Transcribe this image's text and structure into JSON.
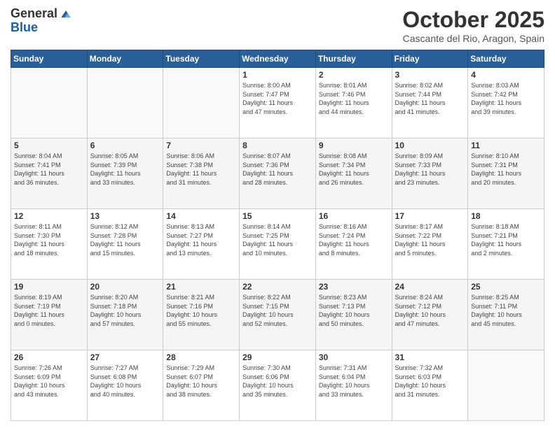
{
  "header": {
    "logo_line1": "General",
    "logo_line2": "Blue",
    "month": "October 2025",
    "location": "Cascante del Rio, Aragon, Spain"
  },
  "days_of_week": [
    "Sunday",
    "Monday",
    "Tuesday",
    "Wednesday",
    "Thursday",
    "Friday",
    "Saturday"
  ],
  "weeks": [
    [
      {
        "day": "",
        "info": ""
      },
      {
        "day": "",
        "info": ""
      },
      {
        "day": "",
        "info": ""
      },
      {
        "day": "1",
        "info": "Sunrise: 8:00 AM\nSunset: 7:47 PM\nDaylight: 11 hours\nand 47 minutes."
      },
      {
        "day": "2",
        "info": "Sunrise: 8:01 AM\nSunset: 7:46 PM\nDaylight: 11 hours\nand 44 minutes."
      },
      {
        "day": "3",
        "info": "Sunrise: 8:02 AM\nSunset: 7:44 PM\nDaylight: 11 hours\nand 41 minutes."
      },
      {
        "day": "4",
        "info": "Sunrise: 8:03 AM\nSunset: 7:42 PM\nDaylight: 11 hours\nand 39 minutes."
      }
    ],
    [
      {
        "day": "5",
        "info": "Sunrise: 8:04 AM\nSunset: 7:41 PM\nDaylight: 11 hours\nand 36 minutes."
      },
      {
        "day": "6",
        "info": "Sunrise: 8:05 AM\nSunset: 7:39 PM\nDaylight: 11 hours\nand 33 minutes."
      },
      {
        "day": "7",
        "info": "Sunrise: 8:06 AM\nSunset: 7:38 PM\nDaylight: 11 hours\nand 31 minutes."
      },
      {
        "day": "8",
        "info": "Sunrise: 8:07 AM\nSunset: 7:36 PM\nDaylight: 11 hours\nand 28 minutes."
      },
      {
        "day": "9",
        "info": "Sunrise: 8:08 AM\nSunset: 7:34 PM\nDaylight: 11 hours\nand 26 minutes."
      },
      {
        "day": "10",
        "info": "Sunrise: 8:09 AM\nSunset: 7:33 PM\nDaylight: 11 hours\nand 23 minutes."
      },
      {
        "day": "11",
        "info": "Sunrise: 8:10 AM\nSunset: 7:31 PM\nDaylight: 11 hours\nand 20 minutes."
      }
    ],
    [
      {
        "day": "12",
        "info": "Sunrise: 8:11 AM\nSunset: 7:30 PM\nDaylight: 11 hours\nand 18 minutes."
      },
      {
        "day": "13",
        "info": "Sunrise: 8:12 AM\nSunset: 7:28 PM\nDaylight: 11 hours\nand 15 minutes."
      },
      {
        "day": "14",
        "info": "Sunrise: 8:13 AM\nSunset: 7:27 PM\nDaylight: 11 hours\nand 13 minutes."
      },
      {
        "day": "15",
        "info": "Sunrise: 8:14 AM\nSunset: 7:25 PM\nDaylight: 11 hours\nand 10 minutes."
      },
      {
        "day": "16",
        "info": "Sunrise: 8:16 AM\nSunset: 7:24 PM\nDaylight: 11 hours\nand 8 minutes."
      },
      {
        "day": "17",
        "info": "Sunrise: 8:17 AM\nSunset: 7:22 PM\nDaylight: 11 hours\nand 5 minutes."
      },
      {
        "day": "18",
        "info": "Sunrise: 8:18 AM\nSunset: 7:21 PM\nDaylight: 11 hours\nand 2 minutes."
      }
    ],
    [
      {
        "day": "19",
        "info": "Sunrise: 8:19 AM\nSunset: 7:19 PM\nDaylight: 11 hours\nand 0 minutes."
      },
      {
        "day": "20",
        "info": "Sunrise: 8:20 AM\nSunset: 7:18 PM\nDaylight: 10 hours\nand 57 minutes."
      },
      {
        "day": "21",
        "info": "Sunrise: 8:21 AM\nSunset: 7:16 PM\nDaylight: 10 hours\nand 55 minutes."
      },
      {
        "day": "22",
        "info": "Sunrise: 8:22 AM\nSunset: 7:15 PM\nDaylight: 10 hours\nand 52 minutes."
      },
      {
        "day": "23",
        "info": "Sunrise: 8:23 AM\nSunset: 7:13 PM\nDaylight: 10 hours\nand 50 minutes."
      },
      {
        "day": "24",
        "info": "Sunrise: 8:24 AM\nSunset: 7:12 PM\nDaylight: 10 hours\nand 47 minutes."
      },
      {
        "day": "25",
        "info": "Sunrise: 8:25 AM\nSunset: 7:11 PM\nDaylight: 10 hours\nand 45 minutes."
      }
    ],
    [
      {
        "day": "26",
        "info": "Sunrise: 7:26 AM\nSunset: 6:09 PM\nDaylight: 10 hours\nand 43 minutes."
      },
      {
        "day": "27",
        "info": "Sunrise: 7:27 AM\nSunset: 6:08 PM\nDaylight: 10 hours\nand 40 minutes."
      },
      {
        "day": "28",
        "info": "Sunrise: 7:29 AM\nSunset: 6:07 PM\nDaylight: 10 hours\nand 38 minutes."
      },
      {
        "day": "29",
        "info": "Sunrise: 7:30 AM\nSunset: 6:06 PM\nDaylight: 10 hours\nand 35 minutes."
      },
      {
        "day": "30",
        "info": "Sunrise: 7:31 AM\nSunset: 6:04 PM\nDaylight: 10 hours\nand 33 minutes."
      },
      {
        "day": "31",
        "info": "Sunrise: 7:32 AM\nSunset: 6:03 PM\nDaylight: 10 hours\nand 31 minutes."
      },
      {
        "day": "",
        "info": ""
      }
    ]
  ]
}
